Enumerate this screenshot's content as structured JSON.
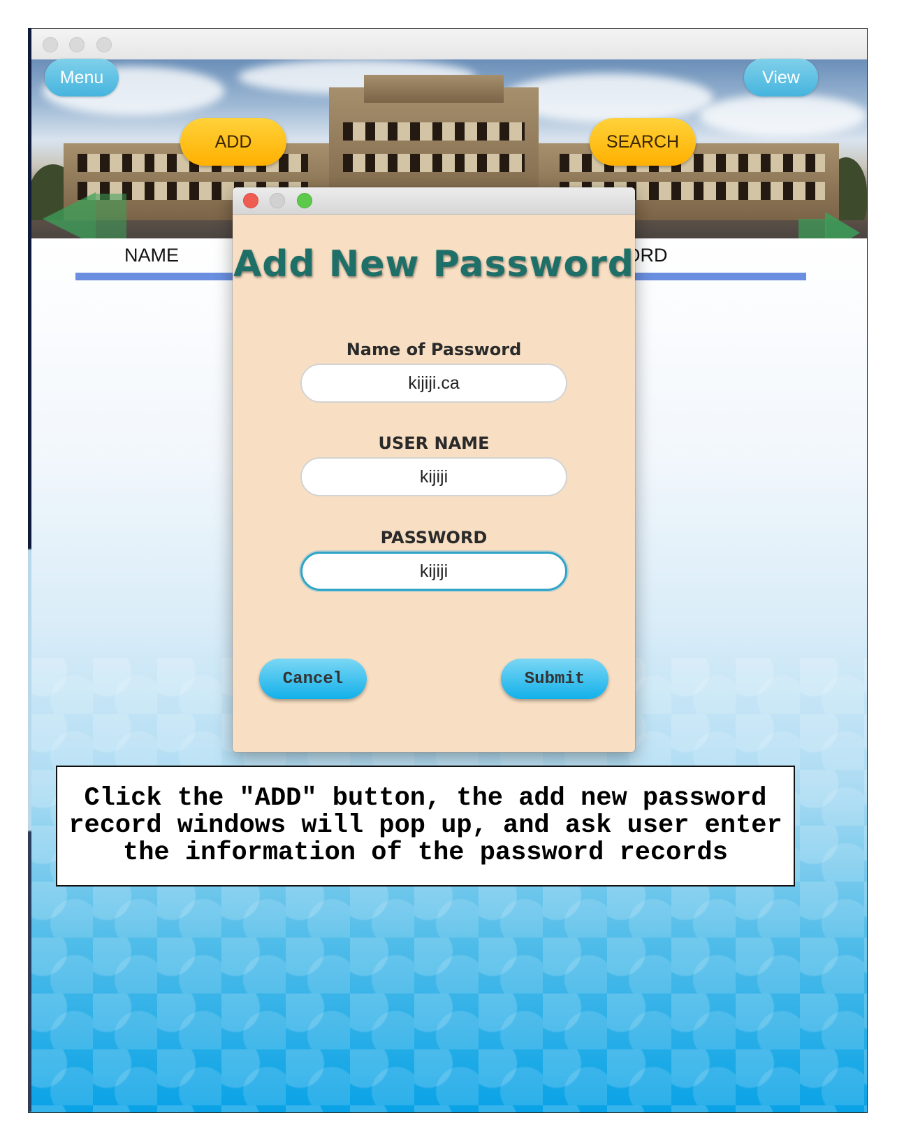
{
  "header": {
    "menu_label": "Menu",
    "view_label": "View",
    "add_label": "ADD",
    "search_label": "SEARCH"
  },
  "table": {
    "col_name": "NAME",
    "col_password_partial": "WORD"
  },
  "dialog": {
    "title": "Add New Password",
    "name_label": "Name of Password",
    "name_value": "kijiji.ca",
    "username_label": "USER NAME",
    "username_value": "kijiji",
    "password_label": "PASSWORD",
    "password_value": "kijiji",
    "cancel_label": "Cancel",
    "submit_label": "Submit"
  },
  "caption": "Click the \"ADD\" button, the add new password record windows will pop up, and ask user enter the information of the password records",
  "colors": {
    "dialog_bg": "#f8dfc3",
    "title_teal": "#1f6f69",
    "add_orange": "#ffc000",
    "accent_blue": "#12b0ea",
    "column_underline": "#6a8fe0"
  }
}
